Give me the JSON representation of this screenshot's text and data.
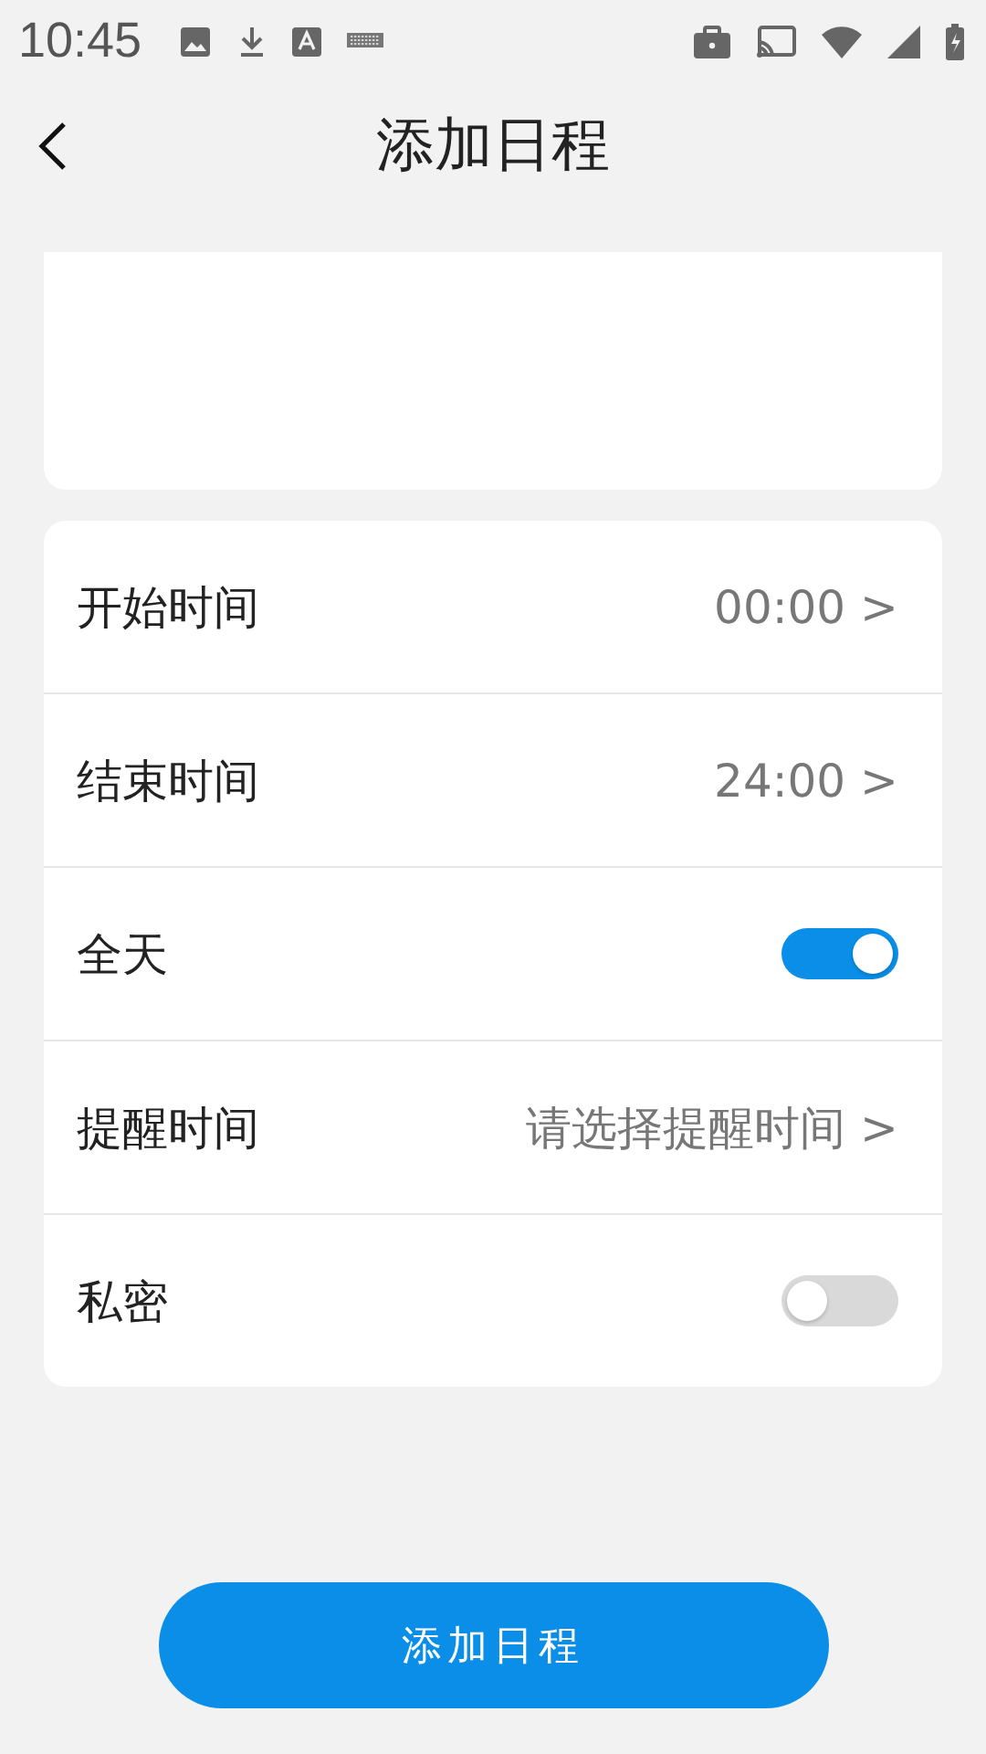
{
  "status_bar": {
    "time": "10:45"
  },
  "header": {
    "title": "添加日程"
  },
  "rows": [
    {
      "kind": "value",
      "label": "开始时间",
      "value": "00:00 >"
    },
    {
      "kind": "value",
      "label": "结束时间",
      "value": "24:00 >"
    },
    {
      "kind": "toggle",
      "label": "全天",
      "on": true
    },
    {
      "kind": "value",
      "label": "提醒时间",
      "value": "请选择提醒时间 >"
    },
    {
      "kind": "toggle",
      "label": "私密",
      "on": false
    }
  ],
  "submit_button": "添加日程"
}
